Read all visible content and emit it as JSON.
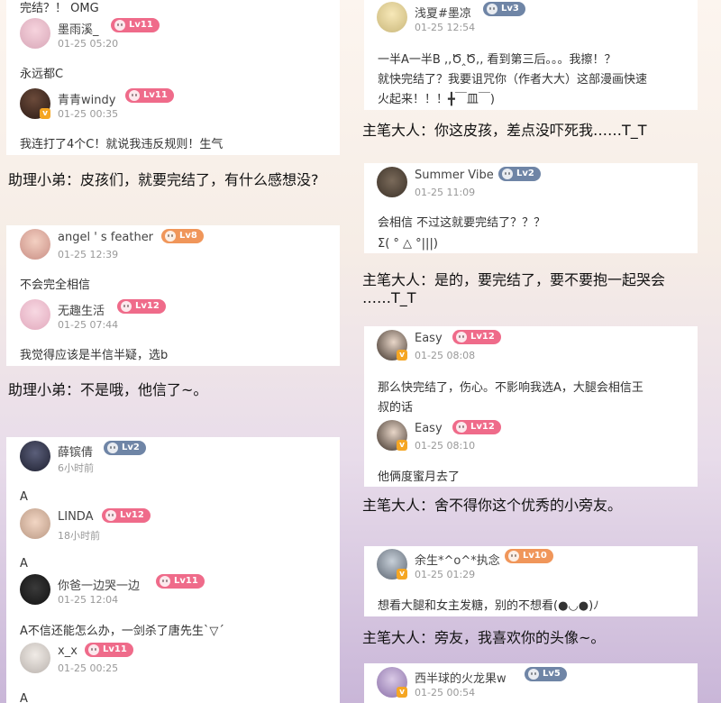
{
  "left_col": {
    "card1": {
      "top_text": "完结？！ OMG",
      "c1": {
        "name": "墨雨溪_",
        "level": "Lv11",
        "time": "01-25 05:20",
        "text": "永远都C"
      },
      "c2": {
        "name": "青青windy",
        "level": "Lv11",
        "time": "01-25 00:35",
        "text": "我连打了4个C！就说我违反规则！生气"
      }
    },
    "caption1": "助理小弟：皮孩们，就要完结了，有什么感想没?",
    "card2": {
      "c1": {
        "name": "angel ' s feather",
        "level": "Lv8",
        "time": "01-25 12:39",
        "text": "不会完全相信"
      },
      "c2": {
        "name": "无趣生活",
        "level": "Lv12",
        "time": "01-25 07:44",
        "text": "我觉得应该是半信半疑，选b"
      }
    },
    "caption2": "助理小弟：不是哦，他信了~。",
    "card3": {
      "c1": {
        "name": "薛镔倩",
        "level": "Lv2",
        "time": "6小时前",
        "text": "A"
      },
      "c2": {
        "name": "LINDA",
        "level": "Lv12",
        "time": "18小时前",
        "text": "A"
      },
      "c3": {
        "name": "你爸一边哭一边",
        "level": "Lv11",
        "time": "01-25 12:04",
        "text": "A不信还能怎么办，一剑杀了唐先生`▽´"
      },
      "c4": {
        "name": "x_x",
        "level": "Lv11",
        "time": "01-25 00:25",
        "text": "A"
      }
    }
  },
  "right_col": {
    "card1": {
      "c1": {
        "name": "浅夏#墨凉",
        "level": "Lv3",
        "time": "01-25 12:54",
        "text1": "一半A一半B ,,Ծ‸Ծ,, 看到第三后。。。我擦！？",
        "text2": "就快完结了？我要诅咒你（作者大大）这部漫画快速",
        "text3": "火起来！！！╋￣皿￣)"
      }
    },
    "caption1": "主笔大人：你这皮孩，差点没吓死我……T_T",
    "card2": {
      "c1": {
        "name": "Summer Vibe",
        "level": "Lv2",
        "time": "01-25 11:09",
        "text1": "会相信  不过这就要完结了？？？",
        "text2": "Σ( ° △ °|||)"
      }
    },
    "caption2a": "主笔大人：是的，要完结了，要不要抱一起哭会",
    "caption2b": "……T_T",
    "card3": {
      "c1": {
        "name": "Easy",
        "level": "Lv12",
        "time": "01-25 08:08",
        "text1": "那么快完结了，伤心。不影响我选A，大腿会相信王",
        "text2": "叔的话"
      },
      "c2": {
        "name": "Easy",
        "level": "Lv12",
        "time": "01-25 08:10",
        "text": "他俩度蜜月去了"
      }
    },
    "caption3": "主笔大人：舍不得你这个优秀的小旁友。",
    "card4": {
      "c1": {
        "name": "余生*^o^*执念",
        "level": "Lv10",
        "time": "01-25 01:29",
        "text": "想看大腿和女主发糖，别的不想看(●◡●)ﾉ"
      }
    },
    "caption4": "主笔大人：旁友，我喜欢你的头像~。",
    "card5": {
      "c1": {
        "name": "西半球的火龙果w",
        "level": "Lv5",
        "time": "01-25 00:54"
      }
    }
  },
  "colors": {
    "pink_badge": "#ef6b8a",
    "blue_badge": "#6f85a6",
    "orange_badge": "#f0965a"
  }
}
